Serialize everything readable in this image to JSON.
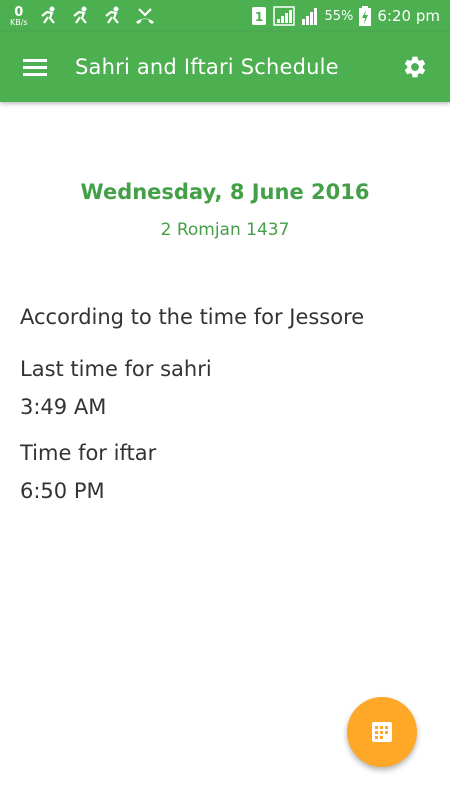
{
  "status_bar": {
    "data_speed": "0",
    "data_unit": "KB/s",
    "sim_slot": "1",
    "battery": "55%",
    "time": "6:20 pm"
  },
  "app_bar": {
    "title": "Sahri and Iftari Schedule",
    "menu_icon": "hamburger-menu-icon",
    "settings_icon": "gear-icon"
  },
  "date": {
    "gregorian": "Wednesday, 8 June 2016",
    "hijri": "2 Romjan 1437"
  },
  "info": {
    "location_text": "According to the time for Jessore",
    "sahri_label": "Last time for sahri",
    "sahri_time": "3:49 AM",
    "iftar_label": "Time for iftar",
    "iftar_time": "6:50 PM"
  },
  "fab": {
    "icon": "calendar-grid-icon"
  },
  "colors": {
    "primary": "#4caf50",
    "date_text": "#43a047",
    "fab": "#ffa726",
    "body_text": "#333333"
  }
}
